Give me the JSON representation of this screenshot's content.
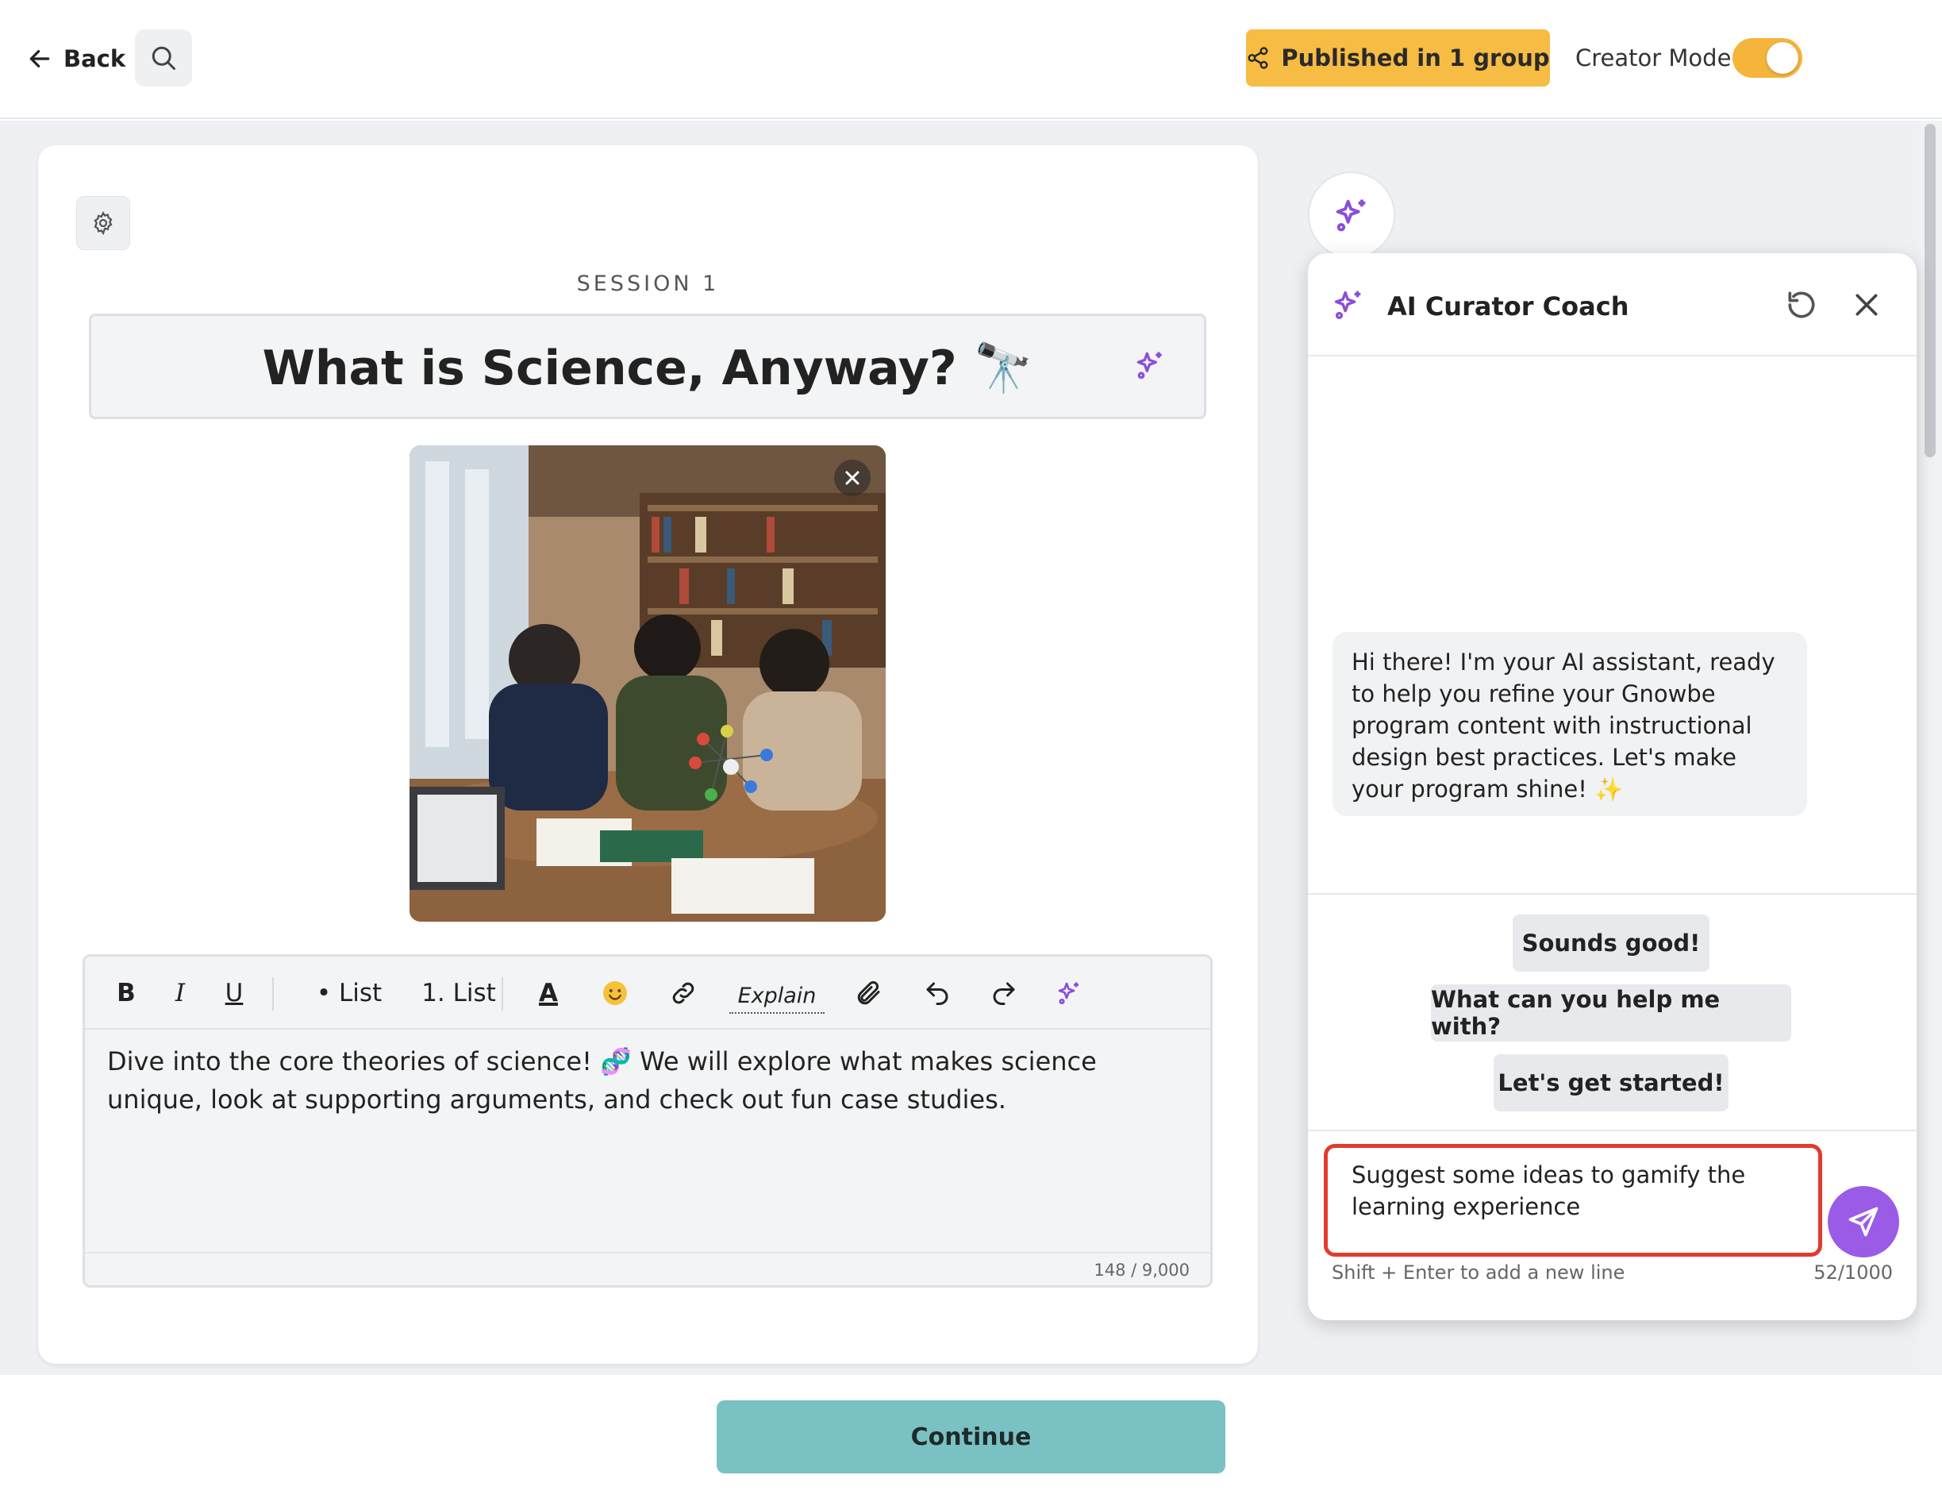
{
  "header": {
    "back_label": "Back",
    "publish_label": "Published in 1 group",
    "creator_mode_label": "Creator Mode",
    "creator_mode_on": true
  },
  "session": {
    "label": "SESSION 1",
    "title": "What is Science, Anyway? 🔭"
  },
  "editor": {
    "toolbar": {
      "bold": "B",
      "italic": "I",
      "underline": "U",
      "bullet_list": "• List",
      "numbered_list": "1. List",
      "text_color": "A",
      "explain": "Explain"
    },
    "content": "Dive into the core theories of science! 🧬 We will explore what makes science unique, look at supporting arguments, and check out fun case studies.",
    "char_count": "148 / 9,000"
  },
  "footer": {
    "continue_label": "Continue"
  },
  "coach": {
    "title": "AI Curator Coach",
    "message": "Hi there! I'm your AI assistant, ready to help you refine your Gnowbe program content with instructional design best practices. Let's make your program shine! ✨",
    "suggestions": [
      "Sounds good!",
      "What can you help me with?",
      "Let's get started!"
    ],
    "input_value": "Suggest some ideas to gamify the learning experience",
    "hint": "Shift + Enter to add a new line",
    "count": "52/1000"
  },
  "colors": {
    "accent_purple": "#9a5ce6",
    "publish_yellow": "#f7bc44",
    "continue_teal": "#7ac1c4",
    "highlight_red": "#e23b2e"
  }
}
